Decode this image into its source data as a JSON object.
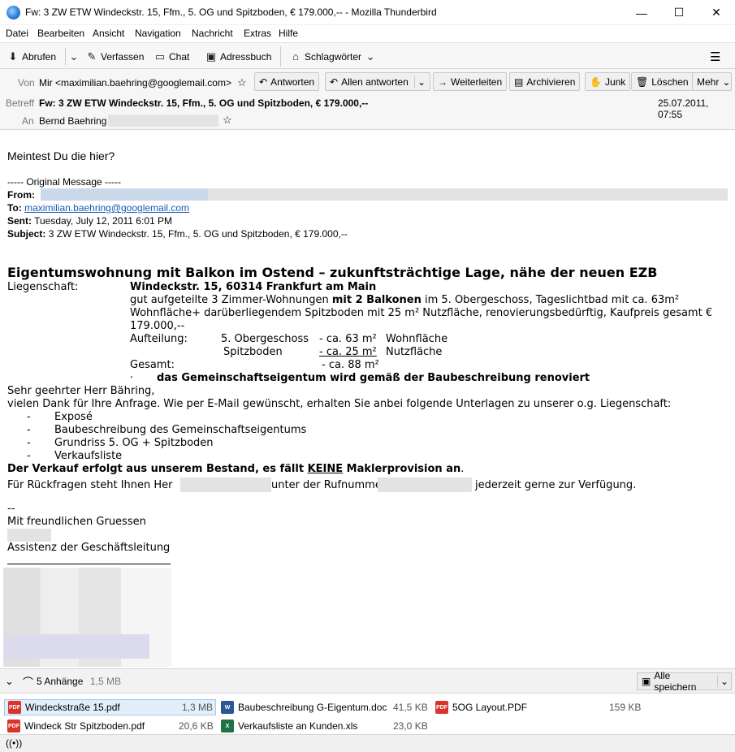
{
  "window": {
    "title": "Fw: 3 ZW ETW Windeckstr. 15, Ffm., 5. OG und Spitzboden, € 179.000,-- - Mozilla Thunderbird",
    "minimize": "—",
    "maximize": "☐",
    "close": "✕"
  },
  "menu": [
    "Datei",
    "Bearbeiten",
    "Ansicht",
    "Navigation",
    "Nachricht",
    "Extras",
    "Hilfe"
  ],
  "toolbar": {
    "fetch": "Abrufen",
    "compose": "Verfassen",
    "chat": "Chat",
    "addressbook": "Adressbuch",
    "tags": "Schlagwörter",
    "menu_icon": "☰"
  },
  "header": {
    "from_label": "Von",
    "from_value": "Mir <maximilian.baehring@googlemail.com>",
    "subject_label": "Betreff",
    "subject_value": "Fw: 3 ZW ETW Windeckstr. 15, Ffm., 5. OG und Spitzboden, € 179.000,--",
    "date": "25.07.2011, 07:55",
    "to_label": "An",
    "to_value": "Bernd Baehring",
    "buttons": {
      "reply": "Antworten",
      "reply_all": "Allen antworten",
      "forward": "Weiterleiten",
      "archive": "Archivieren",
      "junk": "Junk",
      "delete": "Löschen",
      "more": "Mehr"
    }
  },
  "message": {
    "intro": "Meintest Du die hier?",
    "original_marker": "----- Original Message -----",
    "from_label": "From:",
    "to_label": "To:",
    "to_value": "maximilian.baehring@googlemail.com",
    "sent_label": "Sent:",
    "sent_value": "Tuesday, July 12, 2011 6:01 PM",
    "subject_label": "Subject:",
    "subject_value": "3 ZW ETW Windeckstr. 15, Ffm., 5. OG und Spitzboden, € 179.000,--",
    "headline": "Eigentumswohnung mit Balkon im Ostend – zukunftsträchtige Lage, nähe der neuen EZB",
    "property_label": "Liegenschaft:",
    "address": "Windeckstr. 15, 60314 Frankfurt am Main",
    "desc1_a": "gut aufgeteilte 3 Zimmer-Wohnungen ",
    "desc1_b": "mit 2 Balkonen",
    "desc1_c": " im 5. Obergeschoss, Tageslichtbad mit ca. 63m²",
    "desc2": "Wohnfläche+ darüberliegendem Spitzboden mit 25 m² Nutzfläche, renovierungsbedürftig, Kaufpreis gesamt €",
    "desc3": "179.000,--",
    "division_label": "Aufteilung:",
    "floor1": "5. Obergeschoss",
    "floor1_val": "- ca. 63 m²",
    "floor1_unit": "Wohnfläche",
    "floor2": "Spitzboden",
    "floor2_val": "- ca. 25 m²",
    "floor2_unit": "Nutzfläche",
    "total_label": "Gesamt:",
    "total_val": "- ca. 88 m²",
    "bullet": "·",
    "renovation": "das Gemeinschaftseigentum wird gemäß der Baubeschreibung renoviert",
    "greeting": "Sehr geehrter Herr Bähring,",
    "thanks": "vielen Dank für Ihre Anfrage. Wie per E-Mail gewünscht, erhalten Sie anbei folgende Unterlagen zu unserer o.g. Liegenschaft:",
    "list": [
      "Exposé",
      "Baubeschreibung des Gemeinschaftseigentums",
      "Grundriss 5. OG + Spitzboden",
      "Verkaufsliste"
    ],
    "list_dash": "-",
    "sale_a": "Der Verkauf erfolgt aus unserem Bestand, es fällt ",
    "sale_b": "KEINE",
    "sale_c": " Maklerprovision an",
    "sale_d": ".",
    "contact_a": "Für Rückfragen steht Ihnen Her",
    "contact_b": "unter der Rufnumme",
    "contact_c": "jederzeit gerne zur Verfügung.",
    "sig_dash": "--",
    "closing": "Mit freundlichen Gruessen",
    "role": "Assistenz der Geschäftsleitung"
  },
  "attachments": {
    "summary": "5 Anhänge",
    "total_size": "1,5 MB",
    "save_all": "Alle speichern",
    "items": [
      {
        "name": "Windeckstraße 15.pdf",
        "size": "1,3 MB",
        "type": "PDF"
      },
      {
        "name": "Baubeschreibung G-Eigentum.doc",
        "size": "41,5 KB",
        "type": "W"
      },
      {
        "name": "5OG Layout.PDF",
        "size": "159 KB",
        "type": "PDF"
      },
      {
        "name": "Windeck Str Spitzboden.pdf",
        "size": "20,6 KB",
        "type": "PDF"
      },
      {
        "name": "Verkaufsliste an Kunden.xls",
        "size": "23,0 KB",
        "type": "X"
      }
    ]
  },
  "colors": {
    "accent": "#1a5ab6",
    "pdf": "#d9342b",
    "doc": "#2b5797",
    "xls": "#217346"
  }
}
